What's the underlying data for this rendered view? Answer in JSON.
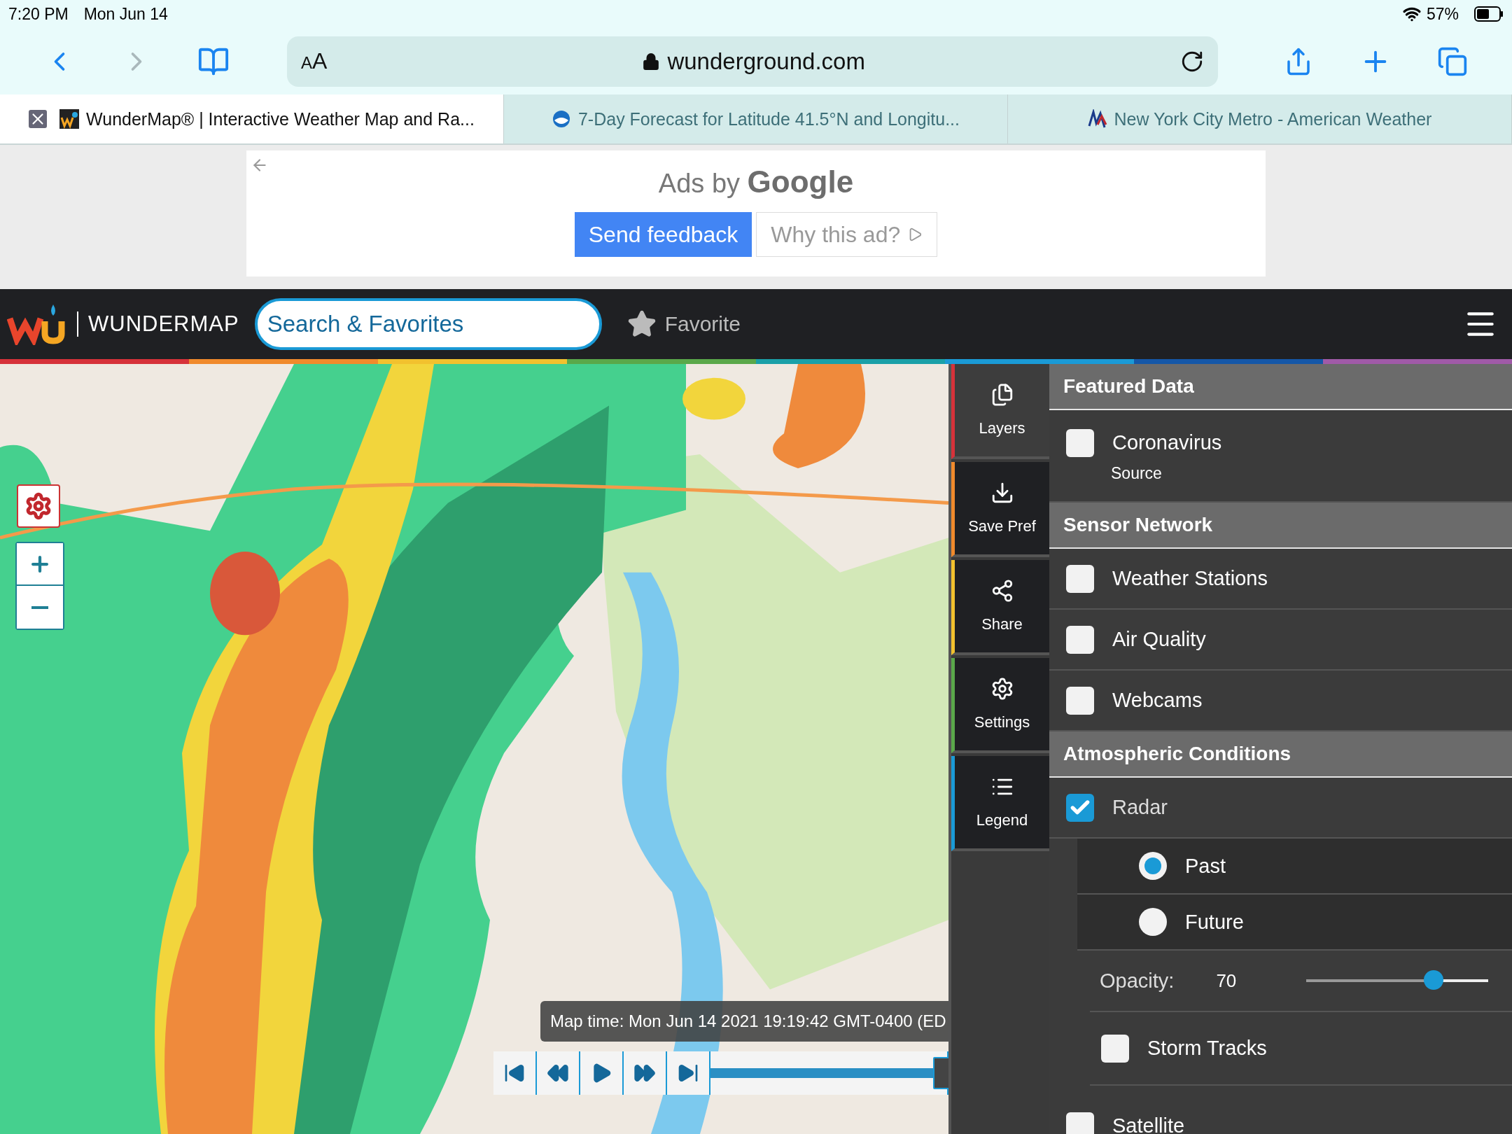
{
  "status_bar": {
    "time": "7:20 PM",
    "date": "Mon Jun 14",
    "battery": "57%"
  },
  "browser": {
    "text_size": "AA",
    "url": "wunderground.com",
    "tabs": [
      {
        "title": "WunderMap® | Interactive Weather Map and Ra...",
        "selected": true
      },
      {
        "title": "7-Day Forecast for Latitude 41.5°N and Longitu...",
        "selected": false
      },
      {
        "title": "New York City Metro - American Weather",
        "selected": false
      }
    ]
  },
  "ad": {
    "title": "Ads by",
    "brand": "Google",
    "buttons": [
      {
        "label": "Send feedback",
        "kind": "primary"
      },
      {
        "label": "Why this ad?",
        "kind": "secondary"
      }
    ]
  },
  "header": {
    "brand": "WUNDERMAP",
    "search": {
      "placeholder": "Search & Favorites"
    },
    "favorite": "Favorite"
  },
  "map": {
    "time": "Map time: Mon Jun 14 2021 19:19:42 GMT-0400 (ED",
    "timeline": {
      "level": 0.97
    }
  },
  "sidebar": {
    "items": [
      {
        "label": "Layers",
        "color": "#d6323a",
        "selected": true
      },
      {
        "label": "Save Pref",
        "color": "#f08a2c",
        "selected": false
      },
      {
        "label": "Share",
        "color": "#f2c12e",
        "selected": false
      },
      {
        "label": "Settings",
        "color": "#5aa84a",
        "selected": false
      },
      {
        "label": "Legend",
        "color": "#1a9ad6",
        "selected": false
      }
    ]
  },
  "layers_panel": {
    "sections": [
      {
        "title": "Featured Data",
        "items": [
          {
            "kind": "checkbox",
            "label": "Coronavirus",
            "sublabel": "Source",
            "checked": false
          }
        ]
      },
      {
        "title": "Sensor Network",
        "items": [
          {
            "kind": "checkbox",
            "label": "Weather Stations",
            "checked": false
          },
          {
            "kind": "checkbox",
            "label": "Air Quality",
            "checked": false
          },
          {
            "kind": "checkbox",
            "label": "Webcams",
            "checked": false
          }
        ]
      },
      {
        "title": "Atmospheric Conditions",
        "items": [
          {
            "kind": "checkbox",
            "label": "Radar",
            "checked": true
          },
          {
            "kind": "radio",
            "label": "Past",
            "selected": true
          },
          {
            "kind": "radio",
            "label": "Future",
            "selected": false
          },
          {
            "kind": "slider",
            "label": "Opacity:",
            "value": "70",
            "level": 0.7
          },
          {
            "kind": "subcheckbox",
            "label": "Storm Tracks",
            "checked": false
          },
          {
            "kind": "checkbox",
            "label": "Satellite",
            "checked": false
          }
        ]
      }
    ]
  }
}
